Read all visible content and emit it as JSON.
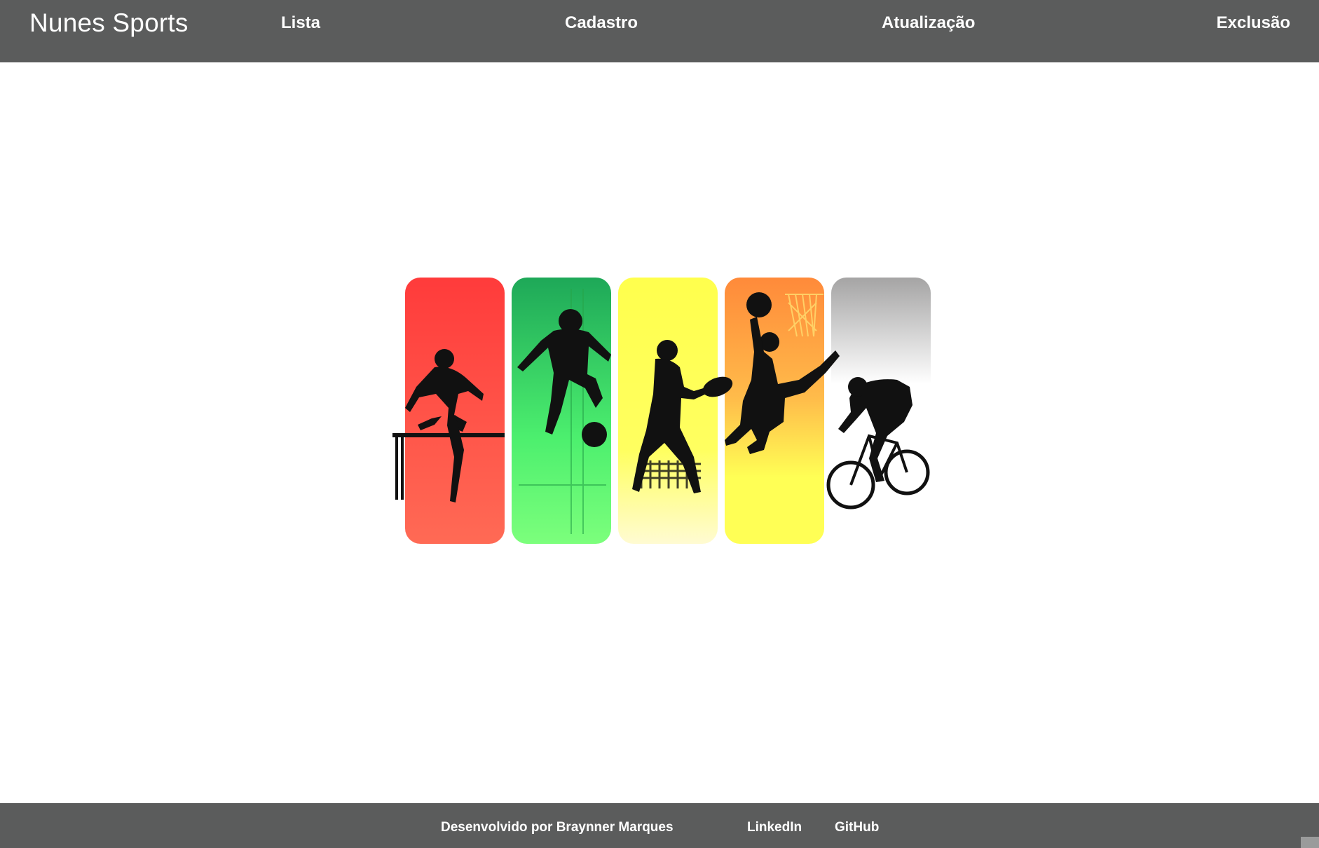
{
  "header": {
    "brand": "Nunes Sports",
    "nav": {
      "lista": "Lista",
      "cadastro": "Cadastro",
      "atualizacao": "Atualização",
      "exclusao": "Exclusão"
    }
  },
  "hero": {
    "panels": [
      {
        "sport": "hurdles",
        "colors": [
          "#ff3b3b",
          "#ff6a55"
        ]
      },
      {
        "sport": "soccer",
        "colors": [
          "#1ea858",
          "#7cff7c"
        ]
      },
      {
        "sport": "rugby",
        "colors": [
          "#ffff4d",
          "#fffbd2"
        ]
      },
      {
        "sport": "basketball",
        "colors": [
          "#ff8a3a",
          "#ffff55"
        ]
      },
      {
        "sport": "cycling",
        "colors": [
          "#a5a4a4",
          "#ffffff"
        ]
      }
    ]
  },
  "footer": {
    "credit": "Desenvolvido por Braynner Marques",
    "linkedin": "LinkedIn",
    "github": "GitHub"
  },
  "colors": {
    "bar": "#5b5c5c",
    "text": "#ffffff",
    "silhouette": "#111111"
  }
}
